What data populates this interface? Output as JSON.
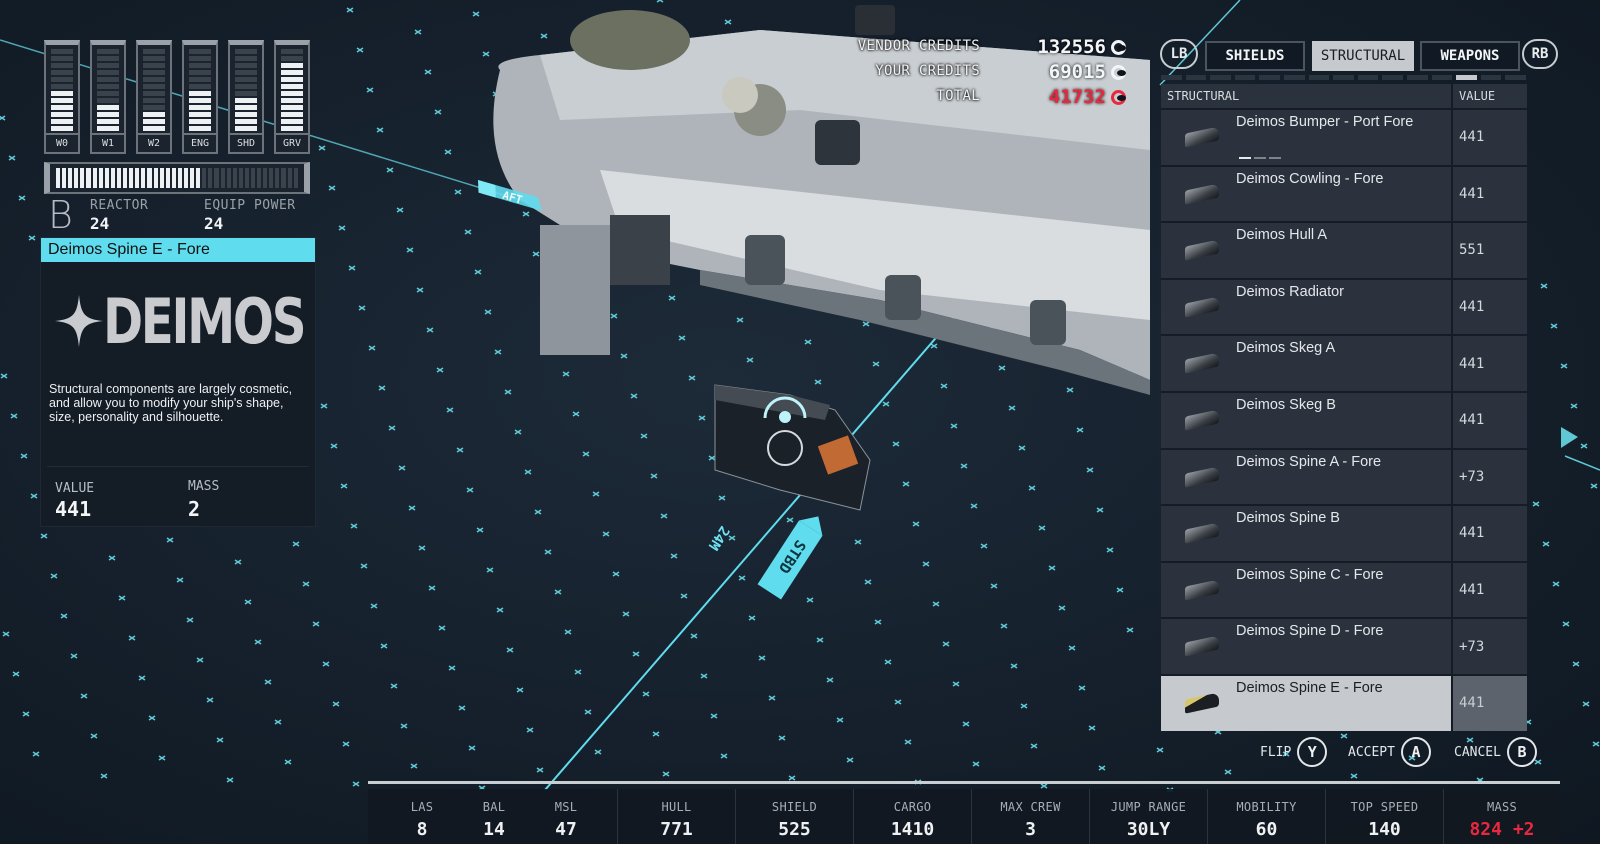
{
  "power": {
    "bars": [
      {
        "label": "W0",
        "level": 6,
        "max": 12
      },
      {
        "label": "W1",
        "level": 4,
        "max": 12
      },
      {
        "label": "W2",
        "level": 3,
        "max": 12
      },
      {
        "label": "ENG",
        "level": 6,
        "max": 12
      },
      {
        "label": "SHD",
        "level": 5,
        "max": 12
      },
      {
        "label": "GRV",
        "level": 10,
        "max": 12
      }
    ],
    "reactor_fill": {
      "used": 24,
      "total": 40
    },
    "reactor_class": "B",
    "reactor_label": "REACTOR",
    "reactor_value": "24",
    "equip_power_label": "EQUIP POWER",
    "equip_power_value": "24"
  },
  "item_info": {
    "title": "Deimos Spine E - Fore",
    "brand_logo": "DEIMOS",
    "brand_icon": "four-point-star-icon",
    "description": "Structural components are largely cosmetic, and allow you to modify your ship's shape, size, personality and silhouette.",
    "value_label": "VALUE",
    "value": "441",
    "mass_label": "MASS",
    "mass": "2"
  },
  "credits": {
    "vendor_label": "VENDOR CREDITS",
    "vendor_value": "132556",
    "your_label": "YOUR CREDITS",
    "your_value": "69015",
    "total_label": "TOTAL",
    "total_value": "41732",
    "currency_icon": "credits-icon",
    "total_color": "#e8283e"
  },
  "tabs": {
    "prev_button": "LB",
    "next_button": "RB",
    "items": [
      {
        "label": "SHIELDS",
        "active": false
      },
      {
        "label": "STRUCTURAL",
        "active": true
      },
      {
        "label": "WEAPONS",
        "active": false
      }
    ],
    "page_indicator": {
      "count": 15,
      "active_index": 12
    }
  },
  "list": {
    "header_name": "STRUCTURAL",
    "header_value": "VALUE",
    "items": [
      {
        "name": "Deimos Bumper - Port Fore",
        "value": "441",
        "selected": false,
        "variants": 3,
        "active_variant": 0
      },
      {
        "name": "Deimos Cowling - Fore",
        "value": "441",
        "selected": false
      },
      {
        "name": "Deimos Hull A",
        "value": "551",
        "selected": false
      },
      {
        "name": "Deimos Radiator",
        "value": "441",
        "selected": false
      },
      {
        "name": "Deimos Skeg A",
        "value": "441",
        "selected": false
      },
      {
        "name": "Deimos Skeg B",
        "value": "441",
        "selected": false
      },
      {
        "name": "Deimos Spine A - Fore",
        "value": "+73",
        "selected": false
      },
      {
        "name": "Deimos Spine B",
        "value": "441",
        "selected": false
      },
      {
        "name": "Deimos Spine C - Fore",
        "value": "441",
        "selected": false
      },
      {
        "name": "Deimos Spine D - Fore",
        "value": "+73",
        "selected": false
      },
      {
        "name": "Deimos Spine E - Fore",
        "value": "441",
        "selected": true
      }
    ]
  },
  "actions": [
    {
      "label": "FLIP",
      "key": "Y"
    },
    {
      "label": "ACCEPT",
      "key": "A"
    },
    {
      "label": "CANCEL",
      "key": "B"
    }
  ],
  "scene": {
    "aft_label": "AFT",
    "stbd_label": "STBD",
    "distance_label": "24M",
    "accent": "#5fdcee"
  },
  "stats": {
    "weapons": [
      {
        "label": "LAS",
        "value": "8"
      },
      {
        "label": "BAL",
        "value": "14"
      },
      {
        "label": "MSL",
        "value": "47"
      }
    ],
    "others": [
      {
        "label": "HULL",
        "value": "771"
      },
      {
        "label": "SHIELD",
        "value": "525"
      },
      {
        "label": "CARGO",
        "value": "1410"
      },
      {
        "label": "MAX CREW",
        "value": "3"
      },
      {
        "label": "JUMP RANGE",
        "value": "30LY"
      },
      {
        "label": "MOBILITY",
        "value": "60"
      },
      {
        "label": "TOP SPEED",
        "value": "140"
      }
    ],
    "mass": {
      "label": "MASS",
      "value": "824",
      "delta": "+2",
      "color": "#e8283e"
    }
  }
}
